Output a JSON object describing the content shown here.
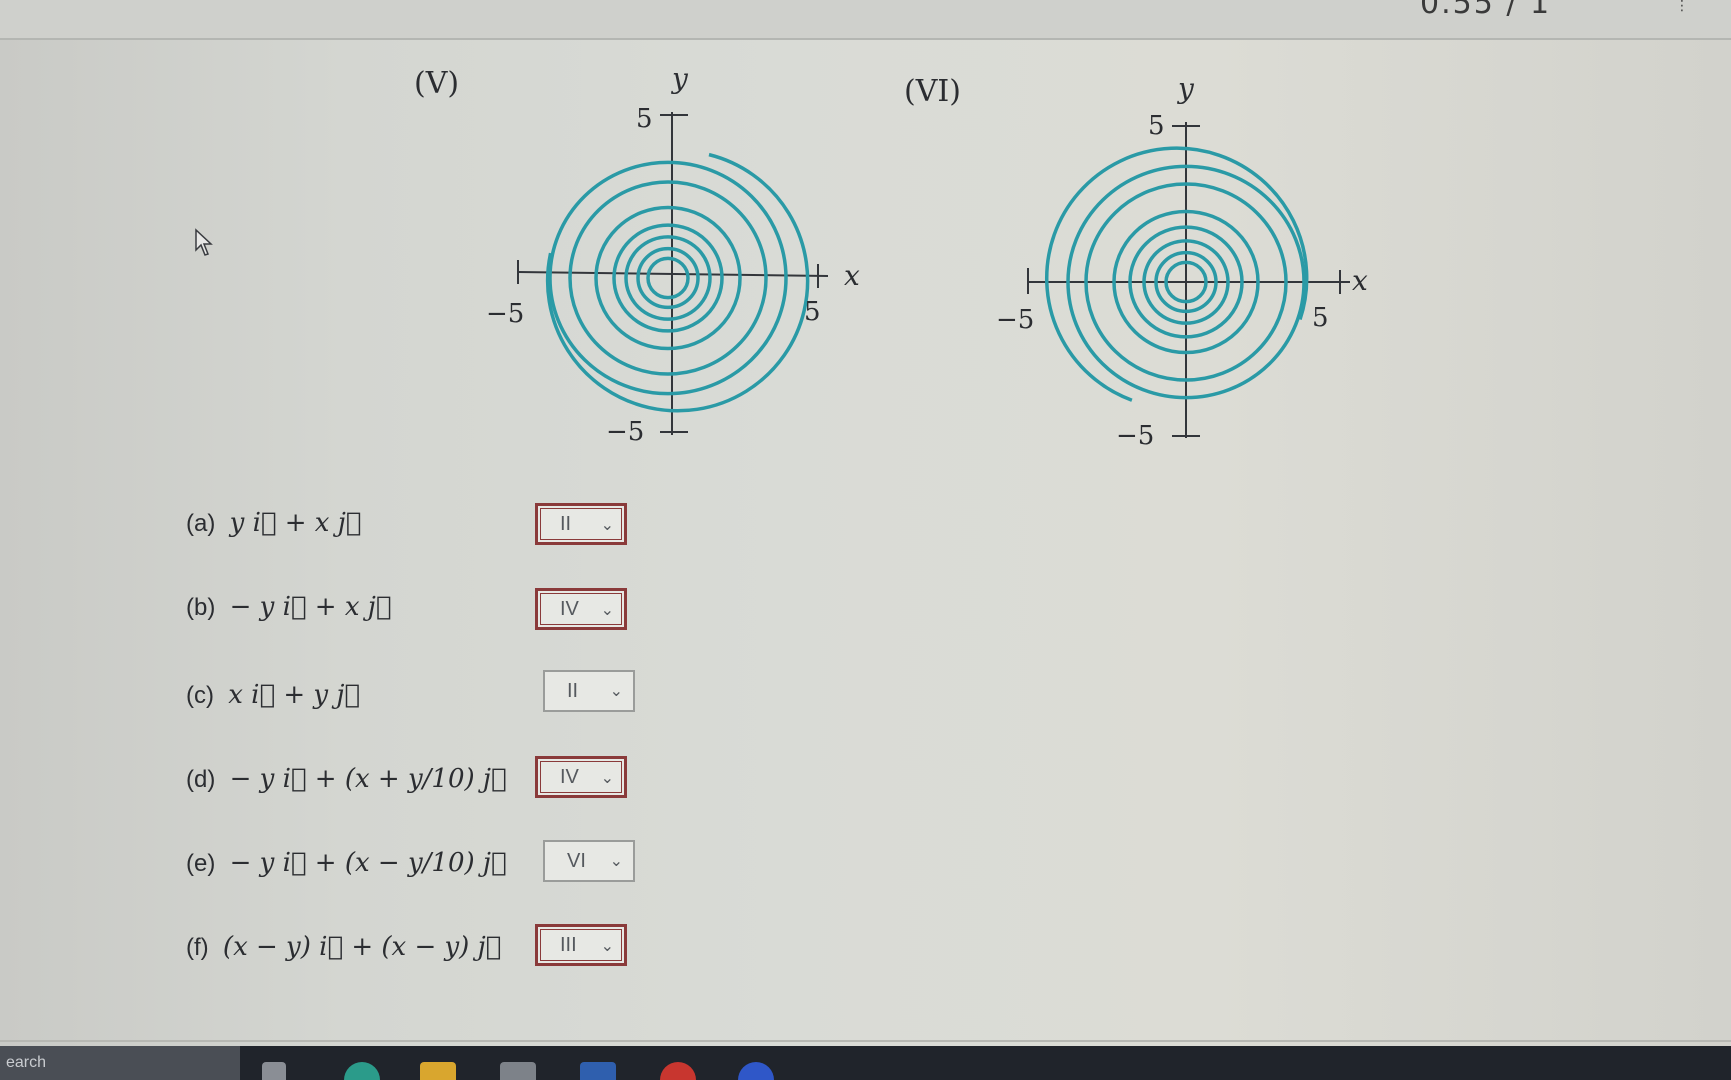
{
  "top": {
    "clipped_text": "0.55 / 1",
    "glyph": "⋮"
  },
  "plots": [
    {
      "label": "(V)",
      "x_axis": "x",
      "y_axis": "y",
      "ticks": {
        "pos_x": "5",
        "neg_x": "−5",
        "pos_y": "5",
        "neg_y": "−5"
      }
    },
    {
      "label": "(VI)",
      "x_axis": "x",
      "y_axis": "y",
      "ticks": {
        "pos_x": "5",
        "neg_x": "−5",
        "pos_y": "5",
        "neg_y": "−5"
      }
    }
  ],
  "questions": [
    {
      "letter": "(a)",
      "expr": "y i⃗ + x j⃗",
      "answer": "II"
    },
    {
      "letter": "(b)",
      "expr": "− y i⃗ + x j⃗",
      "answer": "IV"
    },
    {
      "letter": "(c)",
      "expr": "x i⃗ + y j⃗",
      "answer": "II"
    },
    {
      "letter": "(d)",
      "expr": "− y i⃗ + (x + y/10) j⃗",
      "answer": "IV"
    },
    {
      "letter": "(e)",
      "expr": "− y i⃗ + (x − y/10) j⃗",
      "answer": "VI"
    },
    {
      "letter": "(f)",
      "expr": "(x − y) i⃗ + (x − y) j⃗",
      "answer": "III"
    }
  ],
  "taskbar": {
    "search_text": "earch"
  },
  "colors": {
    "spiral": "#2a9aa6",
    "axis": "#33363b",
    "incorrect_border": "#8a3a3a"
  }
}
